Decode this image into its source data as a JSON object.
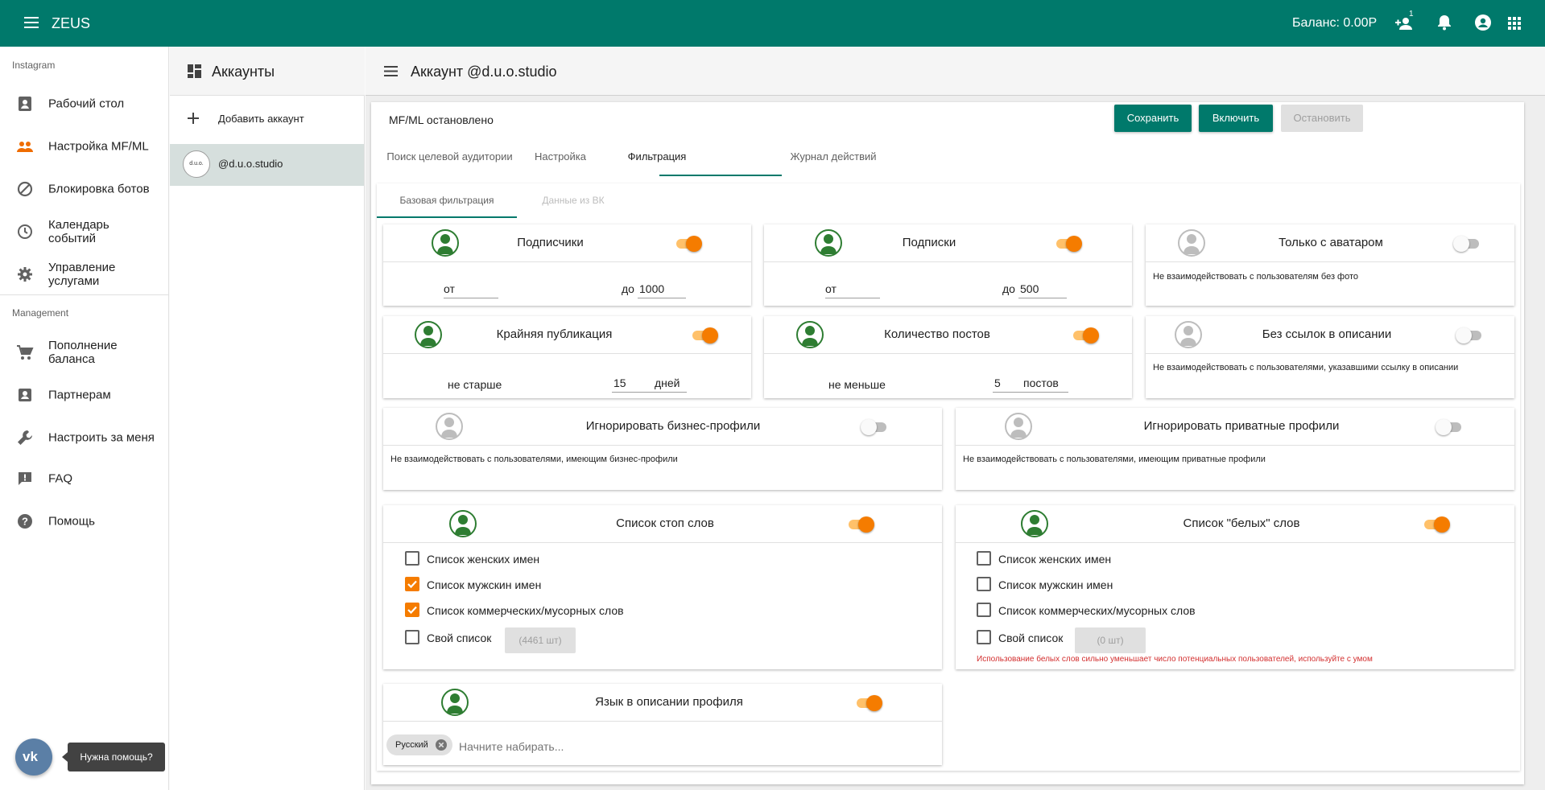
{
  "app": {
    "title": "ZEUS",
    "balance": "Баланс: 0.00Р",
    "friends_badge": "1"
  },
  "sidebar": {
    "section1": "Instagram",
    "items1": [
      {
        "label": "Рабочий стол",
        "icon": "contact-icon"
      },
      {
        "label": "Настройка MF/ML",
        "icon": "people-icon"
      },
      {
        "label": "Блокировка ботов",
        "icon": "block-icon"
      },
      {
        "label": "Календарь событий",
        "icon": "clock-icon"
      },
      {
        "label": "Управление услугами",
        "icon": "gear-icon"
      }
    ],
    "section2": "Management",
    "items2": [
      {
        "label": "Пополнение баланса",
        "icon": "cart-icon"
      },
      {
        "label": "Партнерам",
        "icon": "badge-icon"
      },
      {
        "label": "Настроить за меня",
        "icon": "wrench-icon"
      },
      {
        "label": "FAQ",
        "icon": "feedback-icon"
      },
      {
        "label": "Помощь",
        "icon": "help-icon"
      }
    ]
  },
  "accounts": {
    "title": "Аккаунты",
    "add_label": "Добавить аккаунт",
    "items": [
      {
        "name": "@d.u.o.studio",
        "avatar_text": "d.u.o."
      }
    ]
  },
  "main": {
    "title": "Аккаунт @d.u.o.studio",
    "status": "MF/ML остановлено",
    "buttons": {
      "save": "Сохранить",
      "enable": "Включить",
      "stop": "Остановить"
    },
    "tabs": [
      "Поиск целевой аудитории",
      "Настройка",
      "Фильтрация",
      "Журнал действий"
    ],
    "active_tab": "Фильтрация",
    "subtabs": [
      "Базовая фильтрация",
      "Данные из ВК"
    ]
  },
  "filters": {
    "followers": {
      "title": "Подписчики",
      "from_label": "от",
      "from_value": "",
      "to_label": "до",
      "to_value": "1000",
      "enabled": true
    },
    "following": {
      "title": "Подписки",
      "from_label": "от",
      "from_value": "",
      "to_label": "до",
      "to_value": "500",
      "enabled": true
    },
    "avatar": {
      "title": "Только с аватаром",
      "desc": "Не взаимодействовать с пользователям без фото",
      "enabled": false
    },
    "last_post": {
      "title": "Крайняя публикация",
      "label": "не старше",
      "value": "15",
      "unit": "дней",
      "enabled": true
    },
    "posts": {
      "title": "Количество постов",
      "label": "не меньше",
      "value": "5",
      "unit": "постов",
      "enabled": true
    },
    "no_links": {
      "title": "Без ссылок в описании",
      "desc": "Не взаимодействовать с пользователями, указавшими ссылку в описании",
      "enabled": false
    },
    "business": {
      "title": "Игнорировать бизнес-профили",
      "desc": "Не взаимодействовать с пользователями, имеющим бизнес-профили",
      "enabled": false
    },
    "private": {
      "title": "Игнорировать приватные профили",
      "desc": "Не взаимодействовать с пользователями, имеющим приватные профили",
      "enabled": false
    },
    "stop_words": {
      "title": "Список стоп слов",
      "enabled": true,
      "items": [
        {
          "label": "Список женских имен",
          "checked": false
        },
        {
          "label": "Список мужскин имен",
          "checked": true
        },
        {
          "label": "Список коммерческих/мусорных слов",
          "checked": true
        },
        {
          "label": "Свой список",
          "checked": false
        }
      ],
      "custom_count": "(4461 шт)"
    },
    "white_words": {
      "title": "Список \"белых\" слов",
      "enabled": true,
      "items": [
        {
          "label": "Список женских имен",
          "checked": false
        },
        {
          "label": "Список мужскин имен",
          "checked": false
        },
        {
          "label": "Список коммерческих/мусорных слов",
          "checked": false
        },
        {
          "label": "Свой список",
          "checked": false
        }
      ],
      "custom_count": "(0 шт)",
      "warning": "Использование белых слов сильно уменьшает число потенциальных пользователей, используйте с умом"
    },
    "language": {
      "title": "Язык в описании профиля",
      "enabled": true,
      "chip": "Русский",
      "placeholder": "Начните набирать..."
    }
  },
  "help": {
    "label": "Нужна помощь?"
  },
  "colors": {
    "primary": "#00796b",
    "accent": "#f57c00",
    "warning": "#d32f2f"
  }
}
